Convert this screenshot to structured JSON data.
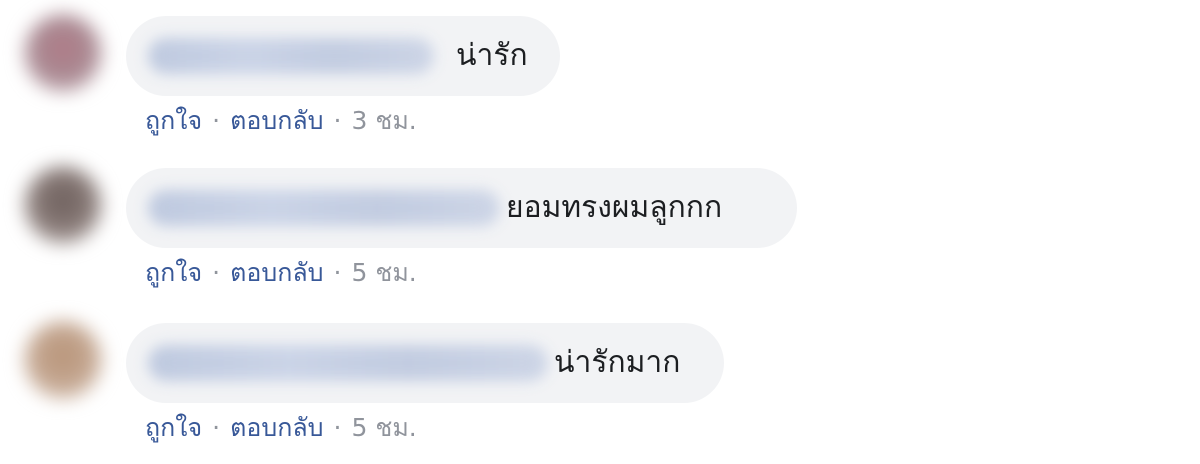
{
  "comments": [
    {
      "text": "น่ารัก",
      "like_label": "ถูกใจ",
      "reply_label": "ตอบกลับ",
      "time": "3 ชม.",
      "avatar_color": "#b07a86"
    },
    {
      "text": "ยอมทรงผมลูกกก",
      "like_label": "ถูกใจ",
      "reply_label": "ตอบกลับ",
      "time": "5 ชม.",
      "avatar_color": "#6d5f5c"
    },
    {
      "text": "น่ารักมาก",
      "like_label": "ถูกใจ",
      "reply_label": "ตอบกลับ",
      "time": "5 ชม.",
      "avatar_color": "#b89478"
    }
  ],
  "separator": "·",
  "colors": {
    "bubble": "#f2f3f5",
    "link": "#385898",
    "meta": "#90949c",
    "text": "#1c1e21"
  }
}
